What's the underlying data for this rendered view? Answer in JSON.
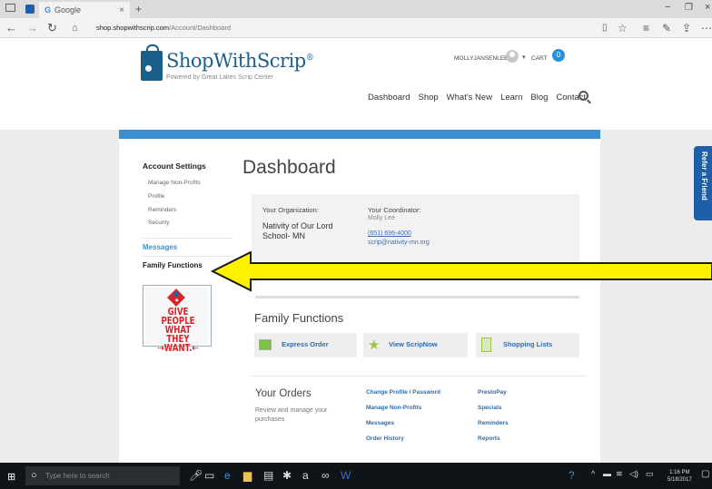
{
  "browser": {
    "tab_title": "Google",
    "url_host": "shop.shopwithscrip.com",
    "url_path": "/Account/Dashboard",
    "new_tab": "+"
  },
  "site": {
    "logo_name": "ShopWithScrip",
    "logo_reg": "®",
    "tagline": "Powered by Great Lakes Scrip Center",
    "username": "MOLLYJANSENLEE",
    "cart_label": "CART",
    "cart_count": "0",
    "nav": [
      "Dashboard",
      "Shop",
      "What's New",
      "Learn",
      "Blog",
      "Contact"
    ]
  },
  "sidebar": {
    "account_settings": "Account Settings",
    "items": [
      "Manage Non-Profits",
      "Profile",
      "Reminders",
      "Security"
    ],
    "messages": "Messages",
    "family_functions": "Family Functions",
    "ad_text": "GIVE PEOPLE WHAT THEY ⇢WANT.⇠"
  },
  "dashboard": {
    "title": "Dashboard",
    "org_label": "Your Organization:",
    "org_name": "Nativity of Our Lord School- MN",
    "coord_label": "Your Coordinator:",
    "coord_name": "Molly Lee",
    "coord_phone": "(651) 696-4000",
    "coord_email": "scrip@nativity-mn.org"
  },
  "family": {
    "title": "Family Functions",
    "buttons": [
      "Express Order",
      "View ScripNow",
      "Shopping Lists"
    ]
  },
  "orders": {
    "title": "Your Orders",
    "desc": "Review and manage your purchases",
    "col1": [
      "Change Profile / Password",
      "Manage Non-Profits",
      "Messages",
      "Order History"
    ],
    "col2": [
      "PrestoPay",
      "Specials",
      "Reminders",
      "Reports"
    ]
  },
  "refer": "Refer a Friend",
  "taskbar": {
    "search_placeholder": "Type here to search",
    "time": "1:16 PM",
    "date": "5/18/2017"
  },
  "colors": {
    "accent": "#3a8fd0",
    "brand": "#1b5e8a",
    "arrow_fill": "#fff200"
  }
}
